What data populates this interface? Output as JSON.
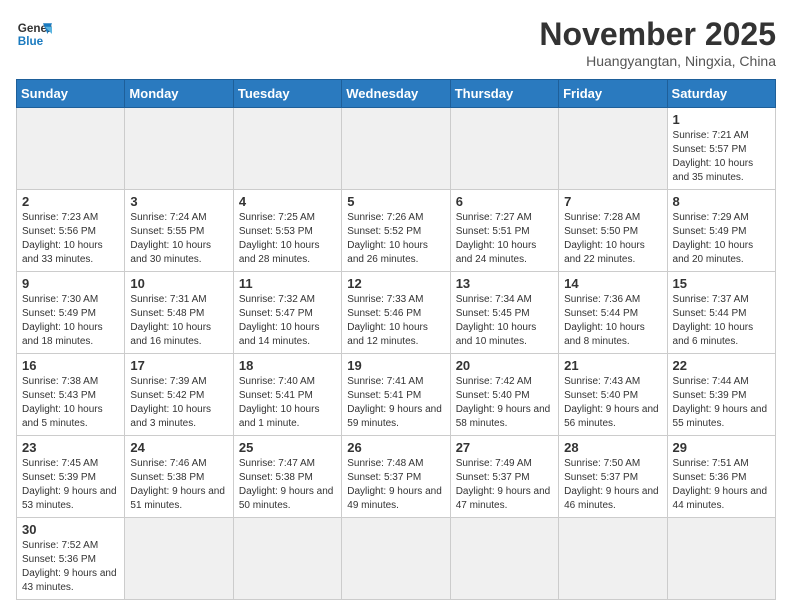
{
  "logo": {
    "text_general": "General",
    "text_blue": "Blue"
  },
  "title": "November 2025",
  "location": "Huangyangtan, Ningxia, China",
  "days_of_week": [
    "Sunday",
    "Monday",
    "Tuesday",
    "Wednesday",
    "Thursday",
    "Friday",
    "Saturday"
  ],
  "weeks": [
    [
      {
        "num": "",
        "info": ""
      },
      {
        "num": "",
        "info": ""
      },
      {
        "num": "",
        "info": ""
      },
      {
        "num": "",
        "info": ""
      },
      {
        "num": "",
        "info": ""
      },
      {
        "num": "",
        "info": ""
      },
      {
        "num": "1",
        "info": "Sunrise: 7:21 AM\nSunset: 5:57 PM\nDaylight: 10 hours and 35 minutes."
      }
    ],
    [
      {
        "num": "2",
        "info": "Sunrise: 7:23 AM\nSunset: 5:56 PM\nDaylight: 10 hours and 33 minutes."
      },
      {
        "num": "3",
        "info": "Sunrise: 7:24 AM\nSunset: 5:55 PM\nDaylight: 10 hours and 30 minutes."
      },
      {
        "num": "4",
        "info": "Sunrise: 7:25 AM\nSunset: 5:53 PM\nDaylight: 10 hours and 28 minutes."
      },
      {
        "num": "5",
        "info": "Sunrise: 7:26 AM\nSunset: 5:52 PM\nDaylight: 10 hours and 26 minutes."
      },
      {
        "num": "6",
        "info": "Sunrise: 7:27 AM\nSunset: 5:51 PM\nDaylight: 10 hours and 24 minutes."
      },
      {
        "num": "7",
        "info": "Sunrise: 7:28 AM\nSunset: 5:50 PM\nDaylight: 10 hours and 22 minutes."
      },
      {
        "num": "8",
        "info": "Sunrise: 7:29 AM\nSunset: 5:49 PM\nDaylight: 10 hours and 20 minutes."
      }
    ],
    [
      {
        "num": "9",
        "info": "Sunrise: 7:30 AM\nSunset: 5:49 PM\nDaylight: 10 hours and 18 minutes."
      },
      {
        "num": "10",
        "info": "Sunrise: 7:31 AM\nSunset: 5:48 PM\nDaylight: 10 hours and 16 minutes."
      },
      {
        "num": "11",
        "info": "Sunrise: 7:32 AM\nSunset: 5:47 PM\nDaylight: 10 hours and 14 minutes."
      },
      {
        "num": "12",
        "info": "Sunrise: 7:33 AM\nSunset: 5:46 PM\nDaylight: 10 hours and 12 minutes."
      },
      {
        "num": "13",
        "info": "Sunrise: 7:34 AM\nSunset: 5:45 PM\nDaylight: 10 hours and 10 minutes."
      },
      {
        "num": "14",
        "info": "Sunrise: 7:36 AM\nSunset: 5:44 PM\nDaylight: 10 hours and 8 minutes."
      },
      {
        "num": "15",
        "info": "Sunrise: 7:37 AM\nSunset: 5:44 PM\nDaylight: 10 hours and 6 minutes."
      }
    ],
    [
      {
        "num": "16",
        "info": "Sunrise: 7:38 AM\nSunset: 5:43 PM\nDaylight: 10 hours and 5 minutes."
      },
      {
        "num": "17",
        "info": "Sunrise: 7:39 AM\nSunset: 5:42 PM\nDaylight: 10 hours and 3 minutes."
      },
      {
        "num": "18",
        "info": "Sunrise: 7:40 AM\nSunset: 5:41 PM\nDaylight: 10 hours and 1 minute."
      },
      {
        "num": "19",
        "info": "Sunrise: 7:41 AM\nSunset: 5:41 PM\nDaylight: 9 hours and 59 minutes."
      },
      {
        "num": "20",
        "info": "Sunrise: 7:42 AM\nSunset: 5:40 PM\nDaylight: 9 hours and 58 minutes."
      },
      {
        "num": "21",
        "info": "Sunrise: 7:43 AM\nSunset: 5:40 PM\nDaylight: 9 hours and 56 minutes."
      },
      {
        "num": "22",
        "info": "Sunrise: 7:44 AM\nSunset: 5:39 PM\nDaylight: 9 hours and 55 minutes."
      }
    ],
    [
      {
        "num": "23",
        "info": "Sunrise: 7:45 AM\nSunset: 5:39 PM\nDaylight: 9 hours and 53 minutes."
      },
      {
        "num": "24",
        "info": "Sunrise: 7:46 AM\nSunset: 5:38 PM\nDaylight: 9 hours and 51 minutes."
      },
      {
        "num": "25",
        "info": "Sunrise: 7:47 AM\nSunset: 5:38 PM\nDaylight: 9 hours and 50 minutes."
      },
      {
        "num": "26",
        "info": "Sunrise: 7:48 AM\nSunset: 5:37 PM\nDaylight: 9 hours and 49 minutes."
      },
      {
        "num": "27",
        "info": "Sunrise: 7:49 AM\nSunset: 5:37 PM\nDaylight: 9 hours and 47 minutes."
      },
      {
        "num": "28",
        "info": "Sunrise: 7:50 AM\nSunset: 5:37 PM\nDaylight: 9 hours and 46 minutes."
      },
      {
        "num": "29",
        "info": "Sunrise: 7:51 AM\nSunset: 5:36 PM\nDaylight: 9 hours and 44 minutes."
      }
    ],
    [
      {
        "num": "30",
        "info": "Sunrise: 7:52 AM\nSunset: 5:36 PM\nDaylight: 9 hours and 43 minutes."
      },
      {
        "num": "",
        "info": ""
      },
      {
        "num": "",
        "info": ""
      },
      {
        "num": "",
        "info": ""
      },
      {
        "num": "",
        "info": ""
      },
      {
        "num": "",
        "info": ""
      },
      {
        "num": "",
        "info": ""
      }
    ]
  ]
}
